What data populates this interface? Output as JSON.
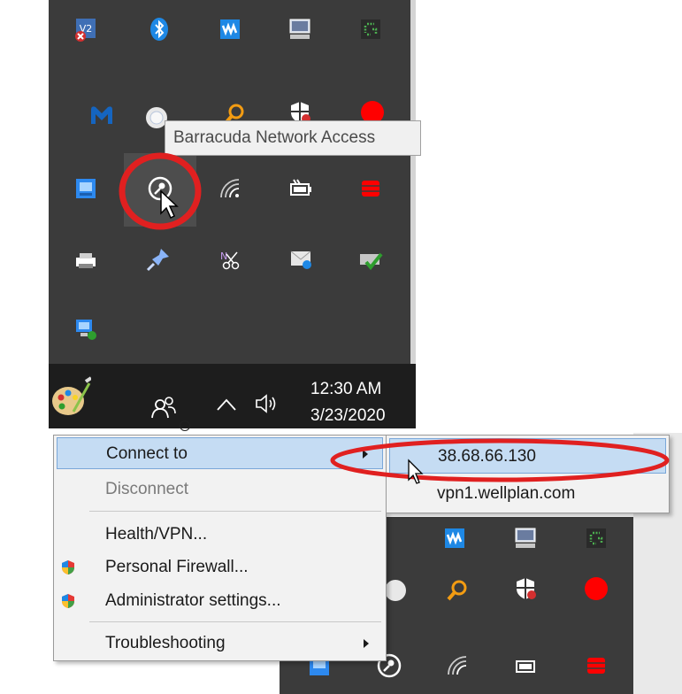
{
  "tooltip": {
    "text": "Barracuda Network Access"
  },
  "taskbar": {
    "time": "12:30 AM",
    "date": "3/23/2020"
  },
  "context_menu": {
    "items": [
      {
        "label": "Connect to",
        "has_submenu": true,
        "selected": true
      },
      {
        "label": "Disconnect",
        "disabled": true
      },
      {
        "label": "Health/VPN..."
      },
      {
        "label": "Personal Firewall...",
        "icon": "shield-icon"
      },
      {
        "label": "Administrator settings...",
        "icon": "shield-icon"
      },
      {
        "label": "Troubleshooting",
        "has_submenu": true
      }
    ]
  },
  "submenu": {
    "items": [
      {
        "label": "38.68.66.130",
        "selected": true
      },
      {
        "label": "vpn1.wellplan.com"
      }
    ]
  },
  "colors": {
    "tray_bg": "#3b3b3b",
    "taskbar_bg": "#1d1d1d",
    "menu_selected": "#c5dcf3",
    "highlight_red": "#e02020"
  },
  "icons": [
    "vnc-icon",
    "bluetooth-icon",
    "network-wave-icon",
    "monitor-icon",
    "green-dotted-icon",
    "malwarebytes-icon",
    "white-circle-icon",
    "search-icon",
    "shield-icon",
    "red-octagon-icon",
    "network-settings-icon",
    "barracuda-key-icon",
    "wifi-icon",
    "battery-icon",
    "red-database-icon",
    "printer-icon",
    "pin-icon",
    "onenote-clip-icon",
    "mail-icon",
    "drive-check-icon",
    "remote-desktop-icon",
    "paint-palette-icon",
    "people-icon",
    "chevron-up-icon",
    "speaker-icon"
  ]
}
